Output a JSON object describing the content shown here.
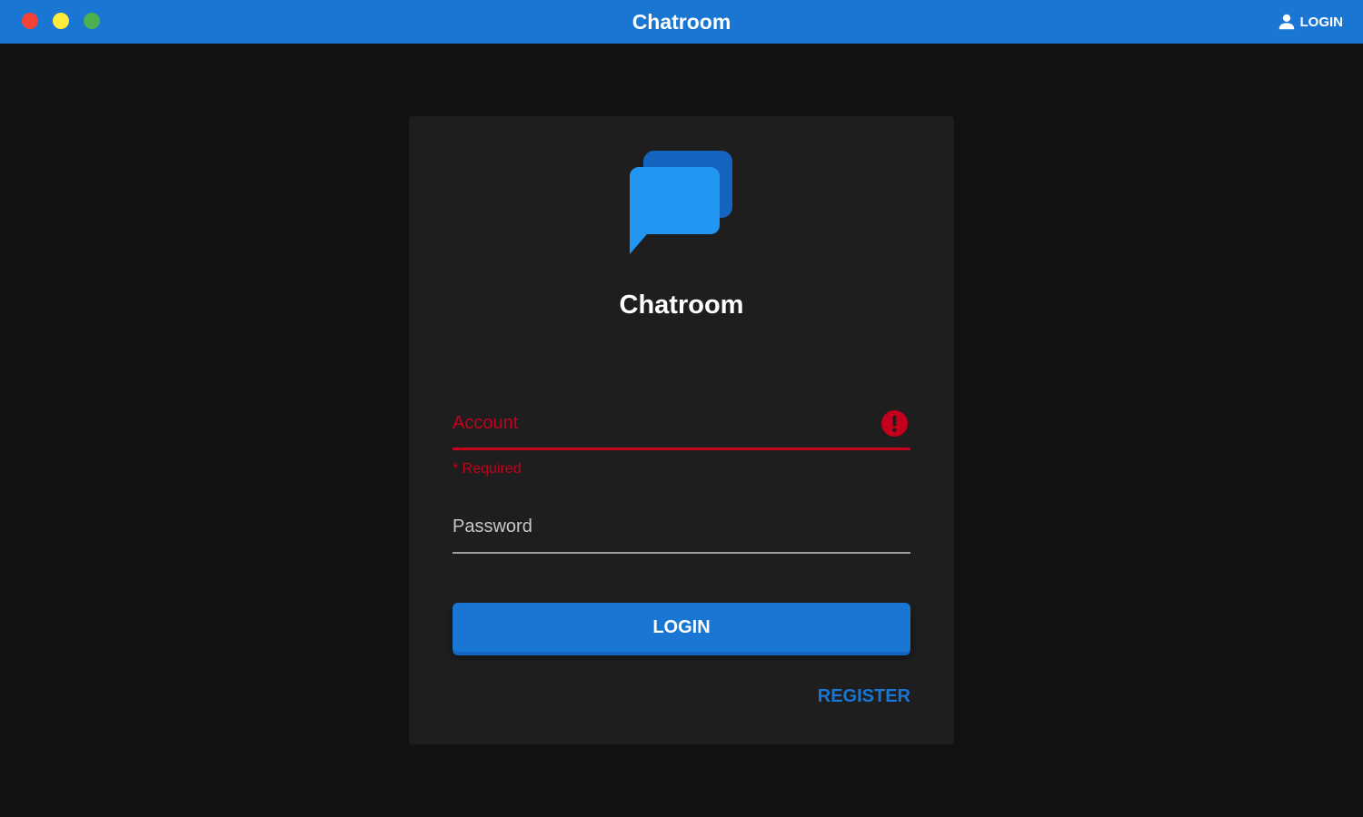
{
  "window": {
    "title": "Chatroom",
    "controls": [
      "close",
      "minimize",
      "maximize"
    ],
    "login_label": "LOGIN",
    "accent_color": "#1976d2"
  },
  "card": {
    "logo_icon": "chat-bubbles-icon",
    "title": "Chatroom",
    "account": {
      "placeholder": "Account",
      "value": "",
      "error": "* Required",
      "error_color": "#c4001d"
    },
    "password": {
      "placeholder": "Password",
      "value": ""
    },
    "login_button": "LOGIN",
    "register_link": "REGISTER"
  }
}
